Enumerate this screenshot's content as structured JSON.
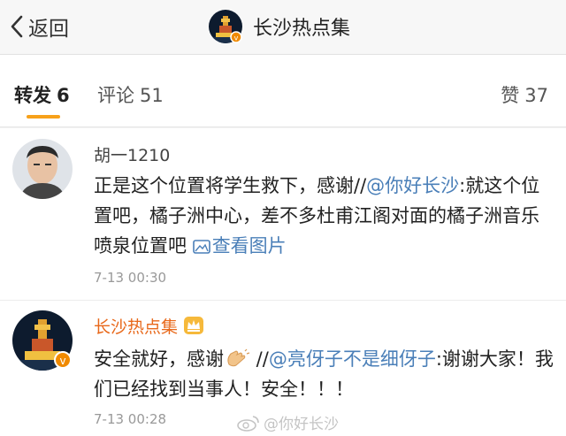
{
  "nav": {
    "back_label": "返回",
    "title": "长沙热点集"
  },
  "tabs": {
    "repost": {
      "label": "转发",
      "count": "6"
    },
    "comment": {
      "label": "评论",
      "count": "51"
    },
    "like": {
      "label": "赞",
      "count": "37"
    }
  },
  "items": [
    {
      "username": "胡一1210",
      "text_before": "正是这个位置将学生救下，感谢//",
      "mention": "@你好长沙",
      "text_after": ":就这个位置吧，橘子洲中心，差不多杜甫江阁对面的橘子洲音乐喷泉位置吧 ",
      "pic_link": "查看图片",
      "time": "7-13 00:30"
    },
    {
      "username": "长沙热点集",
      "text_before": "安全就好，感谢",
      "text_mid": " //",
      "mention": "@亮伢子不是细伢子",
      "text_after": ":谢谢大家！我们已经找到当事人！安全！！！",
      "time": "7-13 00:28"
    }
  ],
  "watermark": "@你好长沙",
  "colors": {
    "accent": "#f7a11a",
    "link": "#4a7fb8",
    "vip_name": "#e8681a",
    "verified_badge": "#f08a00"
  }
}
